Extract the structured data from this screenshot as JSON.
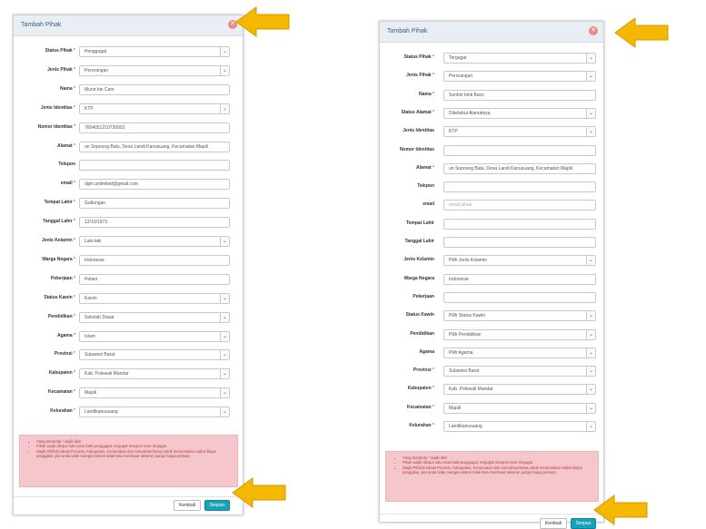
{
  "left_modal": {
    "title": "Tambah Pihak",
    "fields": [
      {
        "label": "Status Pihak",
        "required": "*",
        "value": "Penggugat",
        "type": "select"
      },
      {
        "label": "Jenis Pihak",
        "required": "*",
        "value": "Perorangan",
        "type": "select"
      },
      {
        "label": "Nama",
        "required": "*",
        "value": "Munir bin Cam",
        "type": "input"
      },
      {
        "label": "Jenis Identitas",
        "required": "*",
        "value": "KTP",
        "type": "select"
      },
      {
        "label": "Nomor Identitas",
        "required": "*",
        "value": "7604051210730002",
        "type": "input"
      },
      {
        "label": "Alamat",
        "required": "*",
        "value": "un Sopoong Batu, Desa Landi Kanusuang, Kecamatan Mapili",
        "type": "input"
      },
      {
        "label": "Telepon",
        "required": "",
        "value": "",
        "type": "input"
      },
      {
        "label": "email",
        "required": "*",
        "value": "dgm.unlimited@gmail.com",
        "type": "input"
      },
      {
        "label": "Tempat Lahir",
        "required": "*",
        "value": "Galtungan",
        "type": "input"
      },
      {
        "label": "Tanggal Lahir",
        "required": "*",
        "value": "12/10/1973",
        "type": "input"
      },
      {
        "label": "Jenis Kelamin",
        "required": "*",
        "value": "Laki-laki",
        "type": "select"
      },
      {
        "label": "Warga Negara",
        "required": "*",
        "value": "Indonesia",
        "type": "input"
      },
      {
        "label": "Pekerjaan",
        "required": "*",
        "value": "Petani",
        "type": "input"
      },
      {
        "label": "Status Kawin",
        "required": "*",
        "value": "Kawin",
        "type": "select"
      },
      {
        "label": "Pendidikan",
        "required": "*",
        "value": "Sekolah Dasar",
        "type": "select"
      },
      {
        "label": "Agama",
        "required": "*",
        "value": "Islam",
        "type": "select"
      },
      {
        "label": "Provinsi",
        "required": "*",
        "value": "Sulawesi Barat",
        "type": "select"
      },
      {
        "label": "Kabupaten",
        "required": "*",
        "value": "Kab. Polewali Mandar",
        "type": "select"
      },
      {
        "label": "Kecamatan",
        "required": "*",
        "value": "Mapili",
        "type": "select"
      },
      {
        "label": "Kelurahan",
        "required": "*",
        "value": "Landikanusuang",
        "type": "select"
      }
    ],
    "notice": [
      "Yang bertanda * wajib diisi",
      "Pihak wajib diinput satu-satu baik penggugat, tergugat maupun turut tergugat",
      "Wajib Pilihlah lokasi Provinsi, Kabupaten, Kecamatan dan Kelurahan/Desa untuk menentukan radius biaya panggilan. jika anda tidak mengisi sistem tidak bisa membuat taksiran panjar biaya perkara"
    ],
    "back_label": "Kembali",
    "save_label": "Simpan"
  },
  "right_modal": {
    "title": "Tambah Pihak",
    "fields": [
      {
        "label": "Status Pihak",
        "required": "*",
        "value": "Tergugat",
        "type": "select"
      },
      {
        "label": "Jenis Pihak",
        "required": "*",
        "value": "Perorangan",
        "type": "select"
      },
      {
        "label": "Nama",
        "required": "*",
        "value": "Sunbiri binti Baco",
        "type": "input"
      },
      {
        "label": "Status Alamat",
        "required": "*",
        "value": "Diketahui Alamatnya",
        "type": "select"
      },
      {
        "label": "Jenis Identitas",
        "required": "",
        "value": "KTP",
        "type": "select"
      },
      {
        "label": "Nomor Identitas",
        "required": "",
        "value": "",
        "type": "input"
      },
      {
        "label": "Alamat",
        "required": "*",
        "value": "un Sopoong Batu, Desa Landi Kanusuang, Kecamatan Mapili",
        "type": "input"
      },
      {
        "label": "Telepon",
        "required": "",
        "value": "",
        "type": "input"
      },
      {
        "label": "email",
        "required": "",
        "value": "",
        "placeholder": "email pihak",
        "type": "input"
      },
      {
        "label": "Tempat Lahir",
        "required": "",
        "value": "",
        "type": "input"
      },
      {
        "label": "Tanggal Lahir",
        "required": "",
        "value": "",
        "type": "input"
      },
      {
        "label": "Jenis Kelamin",
        "required": "",
        "value": "Pilih Jenis Kelamin",
        "type": "select"
      },
      {
        "label": "Warga Negara",
        "required": "",
        "value": "Indonesia",
        "type": "input"
      },
      {
        "label": "Pekerjaan",
        "required": "",
        "value": "",
        "type": "input"
      },
      {
        "label": "Status Kawin",
        "required": "",
        "value": "Pilih Status Kawin",
        "type": "select"
      },
      {
        "label": "Pendidikan",
        "required": "",
        "value": "Pilih Pendidikan",
        "type": "select"
      },
      {
        "label": "Agama",
        "required": "",
        "value": "Pilih Agama",
        "type": "select"
      },
      {
        "label": "Provinsi",
        "required": "*",
        "value": "Sulawesi Barat",
        "type": "select"
      },
      {
        "label": "Kabupaten",
        "required": "*",
        "value": "Kab. Polewali Mandar",
        "type": "select"
      },
      {
        "label": "Kecamatan",
        "required": "*",
        "value": "Mapili",
        "type": "select"
      },
      {
        "label": "Kelurahan",
        "required": "*",
        "value": "Landikanusuang",
        "type": "select"
      }
    ],
    "notice": [
      "Yang bertanda * wajib diisi",
      "Pihak wajib diinput satu-satu baik penggugat, tergugat maupun turut tergugat",
      "Wajib Pilihlah lokasi Provinsi, Kabupaten, Kecamatan dan Kelurahan/Desa untuk menentukan radius biaya panggilan. jika anda tidak mengisi sistem tidak bisa membuat taksiran panjar biaya perkara"
    ],
    "back_label": "Kembali",
    "save_label": "Simpan"
  },
  "icons": {
    "close": "close-icon",
    "chevron": "chevron-down-icon",
    "arrow": "arrow-left-icon"
  },
  "colors": {
    "arrow": "#f5b800",
    "save": "#17a2b8",
    "notice_bg": "#f5c6cb",
    "close": "#e98c83"
  }
}
